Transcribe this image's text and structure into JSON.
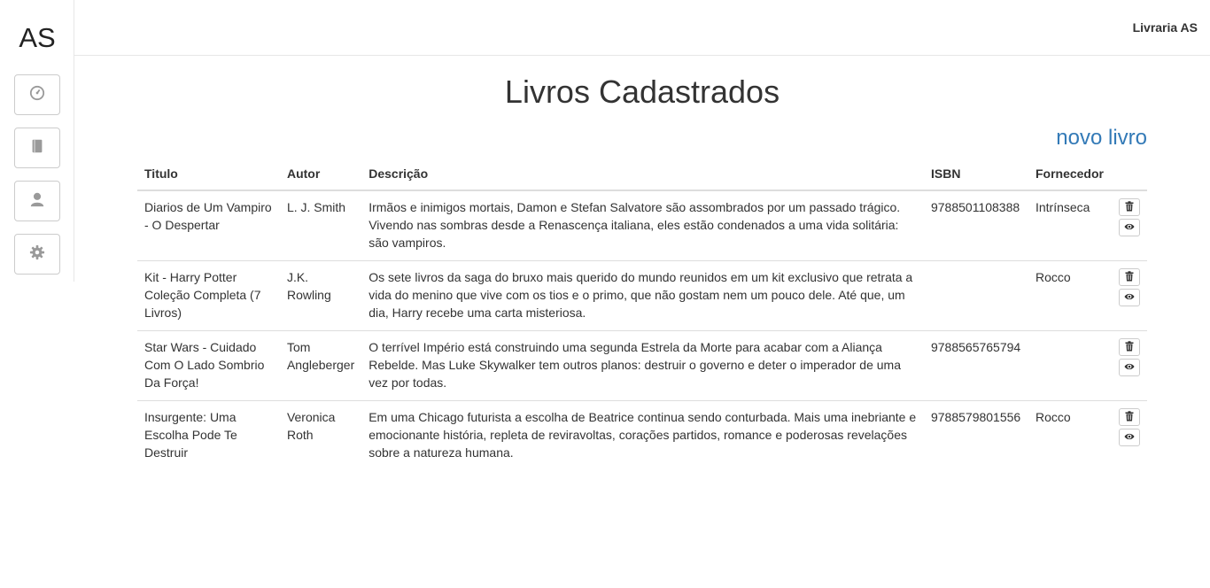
{
  "sidebar": {
    "logo": "AS",
    "items": [
      {
        "icon": "dashboard-icon"
      },
      {
        "icon": "book-icon"
      },
      {
        "icon": "user-icon"
      },
      {
        "icon": "gear-icon"
      }
    ]
  },
  "header": {
    "brand": "Livraria AS"
  },
  "main": {
    "title": "Livros Cadastrados",
    "new_link": "novo livro",
    "columns": {
      "titulo": "Titulo",
      "autor": "Autor",
      "descricao": "Descrição",
      "isbn": "ISBN",
      "fornecedor": "Fornecedor"
    },
    "rows": [
      {
        "titulo": "Diarios de Um Vampiro - O Despertar",
        "autor": "L. J. Smith",
        "descricao": "Irmãos e inimigos mortais, Damon e Stefan Salvatore são assombrados por um passado trágico. Vivendo nas sombras desde a Renascença italiana, eles estão condenados a uma vida solitária: são vampiros.",
        "isbn": "9788501108388",
        "fornecedor": "Intrínseca"
      },
      {
        "titulo": "Kit - Harry Potter Coleção Completa (7 Livros)",
        "autor": "J.K. Rowling",
        "descricao": "Os sete livros da saga do bruxo mais querido do mundo reunidos em um kit exclusivo que retrata a vida do menino que vive com os tios e o primo, que não gostam nem um pouco dele. Até que, um dia, Harry recebe uma carta misteriosa.",
        "isbn": "",
        "fornecedor": "Rocco"
      },
      {
        "titulo": "Star Wars - Cuidado Com O Lado Sombrio Da Força!",
        "autor": "Tom Angleberger",
        "descricao": "O terrível Império está construindo uma segunda Estrela da Morte para acabar com a Aliança Rebelde. Mas Luke Skywalker tem outros planos: destruir o governo e deter o imperador de uma vez por todas.",
        "isbn": "9788565765794",
        "fornecedor": ""
      },
      {
        "titulo": "Insurgente: Uma Escolha Pode Te Destruir",
        "autor": "Veronica Roth",
        "descricao": "Em uma Chicago futurista a escolha de Beatrice continua sendo conturbada. Mais uma inebriante e emocionante história, repleta de reviravoltas, corações partidos, romance e poderosas revelações sobre a natureza humana.",
        "isbn": "9788579801556",
        "fornecedor": "Rocco"
      }
    ],
    "row_actions": [
      {
        "icon": "trash-icon"
      },
      {
        "icon": "eye-icon"
      }
    ]
  },
  "colors": {
    "link": "#337ab7",
    "border": "#dddddd",
    "icon": "#9a9a9a"
  }
}
